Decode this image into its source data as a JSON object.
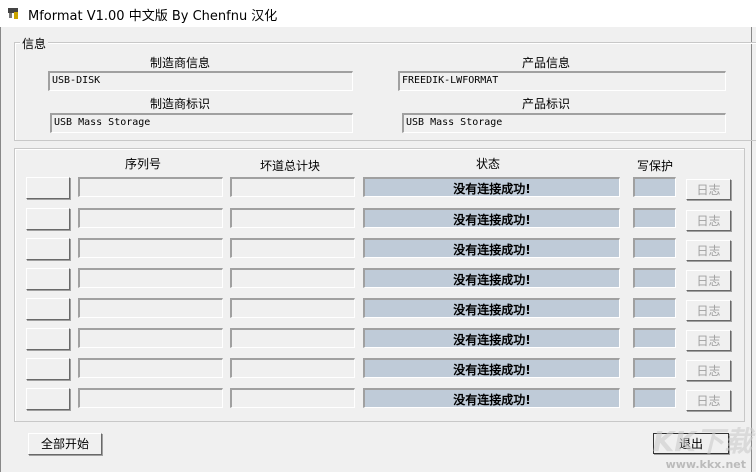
{
  "window": {
    "title": "Mformat V1.00 中文版 By Chenfnu 汉化"
  },
  "info": {
    "group_label": "信息",
    "manufacturer_info_label": "制造商信息",
    "manufacturer_info": "USB-DISK",
    "product_info_label": "产品信息",
    "product_info": "FREEDIK-LWFORMAT",
    "manufacturer_id_label": "制造商标识",
    "manufacturer_id": "USB Mass Storage",
    "product_id_label": "产品标识",
    "product_id": "USB Mass Storage"
  },
  "table": {
    "headers": {
      "serial": "序列号",
      "bad_blocks": "坏道总计块",
      "status": "状态",
      "write_protect": "写保护"
    },
    "rows": [
      {
        "serial": "",
        "bad_blocks": "",
        "status": "没有连接成功!",
        "write_protect": "",
        "log": "日志"
      },
      {
        "serial": "",
        "bad_blocks": "",
        "status": "没有连接成功!",
        "write_protect": "",
        "log": "日志"
      },
      {
        "serial": "",
        "bad_blocks": "",
        "status": "没有连接成功!",
        "write_protect": "",
        "log": "日志"
      },
      {
        "serial": "",
        "bad_blocks": "",
        "status": "没有连接成功!",
        "write_protect": "",
        "log": "日志"
      },
      {
        "serial": "",
        "bad_blocks": "",
        "status": "没有连接成功!",
        "write_protect": "",
        "log": "日志"
      },
      {
        "serial": "",
        "bad_blocks": "",
        "status": "没有连接成功!",
        "write_protect": "",
        "log": "日志"
      },
      {
        "serial": "",
        "bad_blocks": "",
        "status": "没有连接成功!",
        "write_protect": "",
        "log": "日志"
      },
      {
        "serial": "",
        "bad_blocks": "",
        "status": "没有连接成功!",
        "write_protect": "",
        "log": "日志"
      }
    ]
  },
  "buttons": {
    "start_all": "全部开始",
    "exit": "退出"
  },
  "watermark": {
    "logo": "KK下载",
    "url": "www.kkx.net"
  }
}
